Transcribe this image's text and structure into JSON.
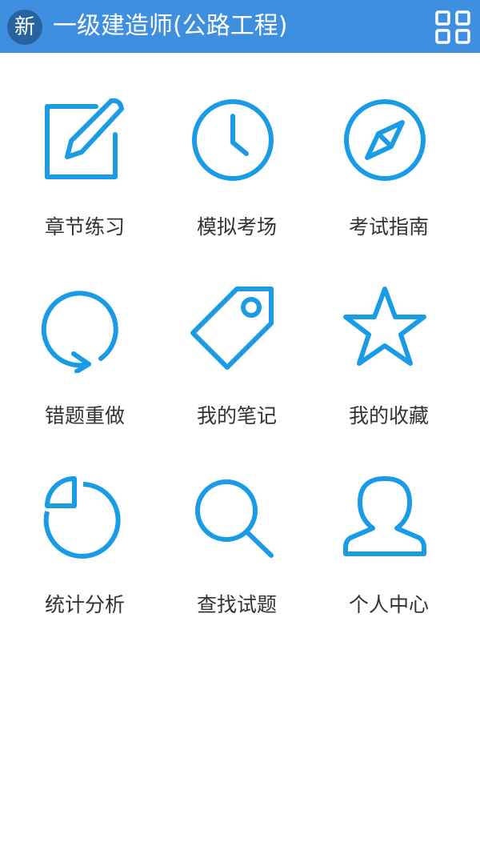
{
  "header": {
    "badge": "新",
    "title": "一级建造师(公路工程)",
    "menu_icon": "grid-icon",
    "background": "#3f8fe0"
  },
  "accent_color": "#1a9be6",
  "menu": [
    {
      "label": "章节练习",
      "icon": "pencil-edit-icon"
    },
    {
      "label": "模拟考场",
      "icon": "clock-icon"
    },
    {
      "label": "考试指南",
      "icon": "compass-icon"
    },
    {
      "label": "错题重做",
      "icon": "refresh-icon"
    },
    {
      "label": "我的笔记",
      "icon": "tag-icon"
    },
    {
      "label": "我的收藏",
      "icon": "star-icon"
    },
    {
      "label": "统计分析",
      "icon": "pie-chart-icon"
    },
    {
      "label": "查找试题",
      "icon": "search-icon"
    },
    {
      "label": "个人中心",
      "icon": "user-icon"
    }
  ]
}
